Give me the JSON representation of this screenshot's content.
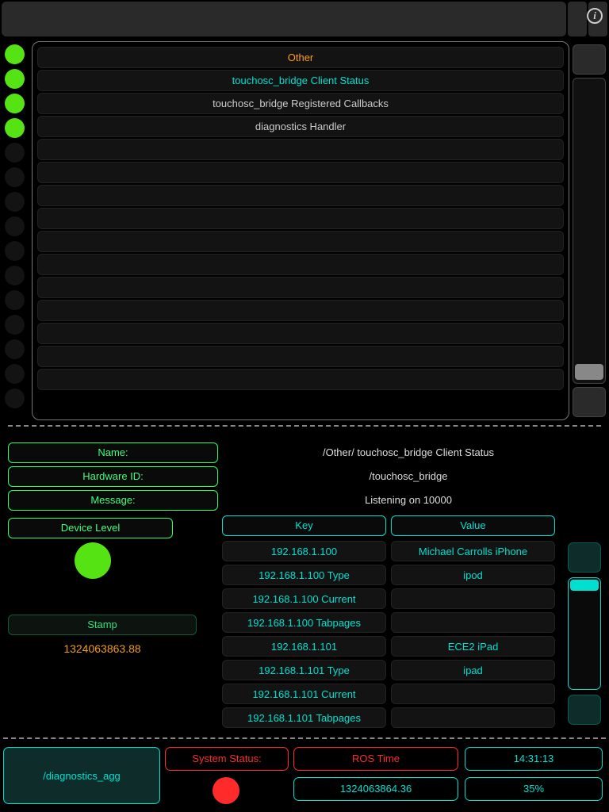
{
  "list": {
    "rows": [
      {
        "label": "Other",
        "color": "#ff9c1a",
        "on": true
      },
      {
        "label": "touchosc_bridge Client Status",
        "color": "#00e0d0",
        "on": true
      },
      {
        "label": "touchosc_bridge Registered Callbacks",
        "color": "#cccccc",
        "on": true
      },
      {
        "label": "diagnostics Handler",
        "color": "#cccccc",
        "on": true
      },
      {
        "label": "",
        "color": "#cccccc",
        "on": false
      },
      {
        "label": "",
        "color": "#cccccc",
        "on": false
      },
      {
        "label": "",
        "color": "#cccccc",
        "on": false
      },
      {
        "label": "",
        "color": "#cccccc",
        "on": false
      },
      {
        "label": "",
        "color": "#cccccc",
        "on": false
      },
      {
        "label": "",
        "color": "#cccccc",
        "on": false
      },
      {
        "label": "",
        "color": "#cccccc",
        "on": false
      },
      {
        "label": "",
        "color": "#cccccc",
        "on": false
      },
      {
        "label": "",
        "color": "#cccccc",
        "on": false
      },
      {
        "label": "",
        "color": "#cccccc",
        "on": false
      },
      {
        "label": "",
        "color": "#cccccc",
        "on": false
      }
    ]
  },
  "detail": {
    "name_label": "Name:",
    "hwid_label": "Hardware ID:",
    "msg_label": "Message:",
    "device_level_label": "Device Level",
    "name_value": "/Other/ touchosc_bridge Client Status",
    "hwid_value": "/touchosc_bridge",
    "msg_value": "Listening on 10000",
    "stamp_label": "Stamp",
    "stamp_value": "1324063863.88"
  },
  "kv": {
    "key_header": "Key",
    "value_header": "Value",
    "rows": [
      {
        "k": "192.168.1.100",
        "v": "Michael Carrolls iPhone"
      },
      {
        "k": "192.168.1.100 Type",
        "v": "ipod"
      },
      {
        "k": "192.168.1.100 Current",
        "v": ""
      },
      {
        "k": "192.168.1.100 Tabpages",
        "v": ""
      },
      {
        "k": "192.168.1.101",
        "v": "ECE2 iPad"
      },
      {
        "k": "192.168.1.101 Type",
        "v": "ipad"
      },
      {
        "k": "192.168.1.101 Current",
        "v": ""
      },
      {
        "k": "192.168.1.101 Tabpages",
        "v": ""
      }
    ]
  },
  "bottom": {
    "diag_topic": "/diagnostics_agg",
    "sys_status_label": "System Status:",
    "ros_time_label": "ROS Time",
    "clock_time": "14:31:13",
    "ros_time_value": "1324063864.36",
    "percent": "35%"
  }
}
